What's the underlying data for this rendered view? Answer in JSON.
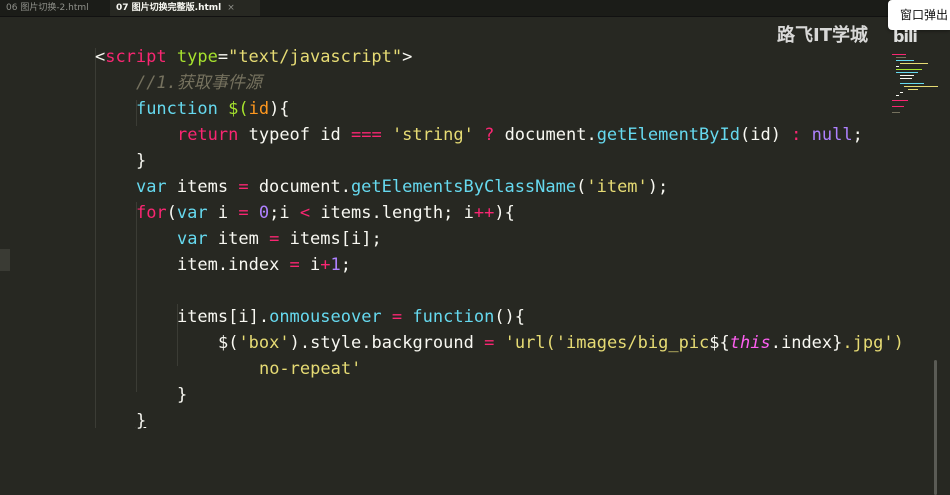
{
  "tabs": [
    {
      "label": "06 图片切换-2.html",
      "active": false
    },
    {
      "label": "07 图片切换完整版.html",
      "active": true,
      "close": "×"
    }
  ],
  "popup": {
    "label": "窗口弹出"
  },
  "watermark": {
    "text": "路飞IT学城",
    "logo": "bili"
  },
  "colors": {
    "background": "#272822",
    "keyword": "#66d9ef",
    "string": "#e6db74",
    "function": "#a6e22e",
    "number": "#ae81ff",
    "operator": "#f92672",
    "comment": "#75715e",
    "parameter": "#fd971f"
  },
  "code": {
    "line1": {
      "lt": "<",
      "tag": "script",
      "attr": "type",
      "eq": "=",
      "val": "\"text/javascript\"",
      "gt": ">"
    },
    "line2": {
      "comment": "//1.获取事件源"
    },
    "line3": {
      "kw": "function",
      "sp": " ",
      "name": "$(",
      "param": "id",
      "close": "){"
    },
    "line4": {
      "ret": "return",
      "t1": " typeof id ",
      "op1": "===",
      "s1": " ",
      "str": "'string'",
      "s2": " ",
      "op2": "?",
      "s3": " document.",
      "fn": "getElementById",
      "t2": "(id) ",
      "op3": ":",
      "s4": " ",
      "nul": "null",
      "end": ";"
    },
    "line5": {
      "brace": "}"
    },
    "line6": {
      "kw": "var",
      "t1": " items ",
      "op": "=",
      "t2": " document.",
      "fn": "getElementsByClassName",
      "t3": "(",
      "str": "'item'",
      "t4": ");"
    },
    "line7": {
      "kw": "for",
      "t1": "(",
      "kw2": "var",
      "t2": " i ",
      "op1": "=",
      "t3": " ",
      "n0": "0",
      "t4": ";i ",
      "op2": "<",
      "t5": " items.length; i",
      "op3": "++",
      "t6": "){"
    },
    "line8": {
      "kw": "var",
      "t1": " item ",
      "op": "=",
      "t2": " items[i];"
    },
    "line9": {
      "t1": "item.index ",
      "op": "=",
      "t2": " i",
      "op2": "+",
      "n1": "1",
      "t3": ";"
    },
    "line10": {
      "t1": "items[i].",
      "prop": "onmouseover",
      "t2": " ",
      "op": "=",
      "t3": " ",
      "kw": "function",
      "t4": "(){"
    },
    "line11": {
      "t1": "$(",
      "str1": "'box'",
      "t2": ").style.background ",
      "op": "=",
      "t3": " ",
      "str2": "'url('images/big_pic",
      "t4": "${",
      "this": "this",
      "t5": ".index}",
      "str3": ".jpg')"
    },
    "line12": {
      "str": "no-repeat'"
    },
    "line13": {
      "brace": "}"
    },
    "line14": {
      "brace": "}"
    }
  }
}
